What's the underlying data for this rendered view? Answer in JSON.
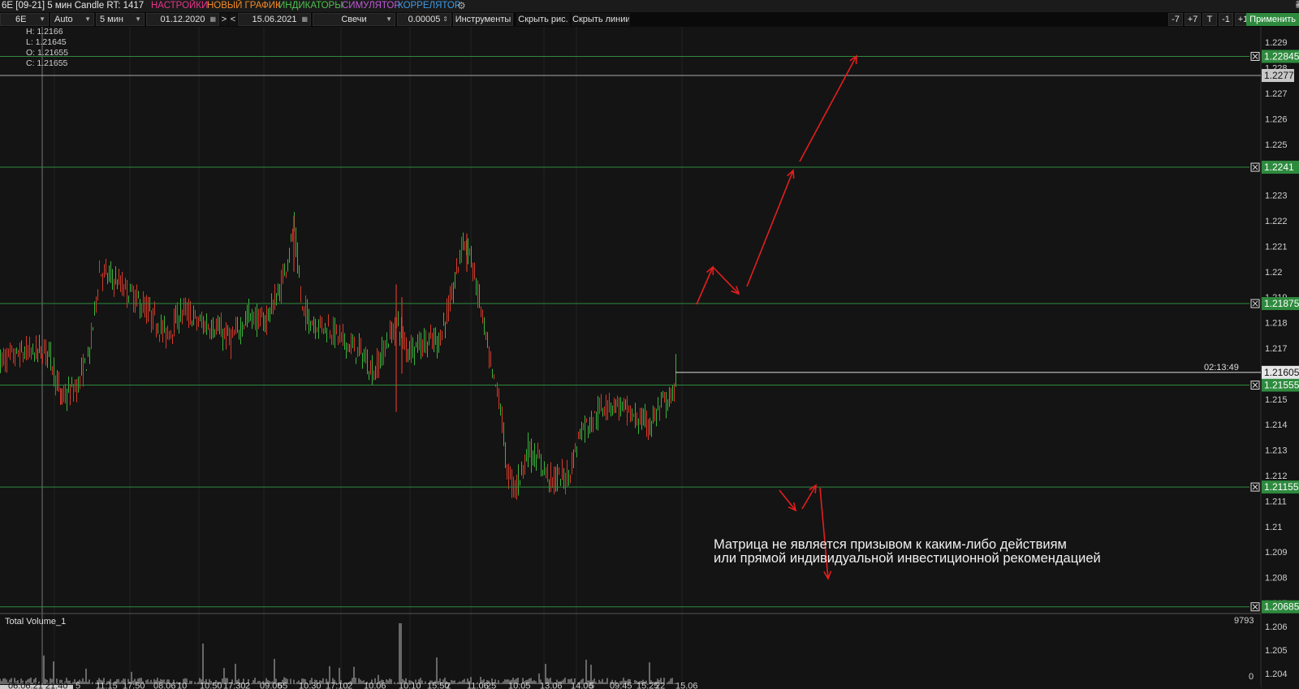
{
  "titlebar": {
    "instrument_title": "6E [09-21] 5 мин Candle RT: 1417",
    "menu": [
      {
        "label": "НАСТРОЙКИ",
        "color": "#e8348c"
      },
      {
        "label": "НОВЫЙ ГРАФИК",
        "color": "#f08a24"
      },
      {
        "label": "ИНДИКАТОРЫ",
        "color": "#4cc04c"
      },
      {
        "label": "СИМУЛЯТОР",
        "color": "#c05ad8"
      },
      {
        "label": "КОРРЕЛЯТОР",
        "color": "#3c9be8"
      }
    ],
    "settings_icon": "gears-icon"
  },
  "toolbar": {
    "symbol": "6E",
    "scale": "Auto",
    "timeframe": "5 мин",
    "date_from": "01.12.2020",
    "nav_next": ">",
    "nav_prev": "<",
    "date_to": "15.06.2021",
    "chart_type": "Свечи",
    "tick_size": "0.00005",
    "instruments": "Инструменты",
    "hide_drawings": "Скрыть рис.",
    "hide_lines": "Скрыть линии",
    "zoom_buttons": [
      "-7",
      "+7",
      "T",
      "-1",
      "+1"
    ],
    "apply": "Применить"
  },
  "ohlc": {
    "high": "H: 1.2166",
    "low": "L: 1.21645",
    "open": "O: 1.21655",
    "close": "C: 1.21655"
  },
  "chart_data": {
    "type": "candlestick",
    "ylim": [
      1.2065,
      1.2295
    ],
    "y_ticks": [
      "1.229",
      "1.228",
      "1.227",
      "1.226",
      "1.225",
      "1.224",
      "1.223",
      "1.222",
      "1.221",
      "1.22",
      "1.219",
      "1.218",
      "1.217",
      "1.216",
      "1.215",
      "1.214",
      "1.213",
      "1.212",
      "1.211",
      "1.21",
      "1.209",
      "1.208",
      "1.207"
    ],
    "x_tick_labels": [
      "06.06.21 21:40",
      "5",
      "11:15",
      "17:50",
      "08.06",
      "10",
      "10:50",
      "17:30",
      "2",
      "09.06",
      "55",
      "10:30",
      "17:10",
      "2",
      "10.06",
      "10:10",
      "15:50",
      "2",
      "11.06",
      "25",
      "10:05",
      "13.06",
      "14.06",
      "5",
      "09:45",
      "15:25",
      "22",
      "15.06"
    ],
    "price_path": [
      [
        0,
        1.2165
      ],
      [
        30,
        1.2168
      ],
      [
        60,
        1.2169
      ],
      [
        75,
        1.215
      ],
      [
        95,
        1.2155
      ],
      [
        110,
        1.2168
      ],
      [
        122,
        1.22
      ],
      [
        140,
        1.2197
      ],
      [
        165,
        1.219
      ],
      [
        185,
        1.2183
      ],
      [
        205,
        1.2175
      ],
      [
        225,
        1.2185
      ],
      [
        245,
        1.218
      ],
      [
        265,
        1.2178
      ],
      [
        285,
        1.2173
      ],
      [
        305,
        1.2183
      ],
      [
        325,
        1.218
      ],
      [
        345,
        1.2193
      ],
      [
        362,
        1.2217
      ],
      [
        372,
        1.2185
      ],
      [
        385,
        1.218
      ],
      [
        405,
        1.2178
      ],
      [
        425,
        1.2172
      ],
      [
        445,
        1.2168
      ],
      [
        460,
        1.216
      ],
      [
        480,
        1.2175
      ],
      [
        490,
        1.218
      ],
      [
        500,
        1.217
      ],
      [
        520,
        1.2172
      ],
      [
        540,
        1.2173
      ],
      [
        555,
        1.2188
      ],
      [
        570,
        1.2213
      ],
      [
        580,
        1.2205
      ],
      [
        595,
        1.218
      ],
      [
        605,
        1.216
      ],
      [
        615,
        1.215
      ],
      [
        625,
        1.212
      ],
      [
        635,
        1.2115
      ],
      [
        650,
        1.213
      ],
      [
        665,
        1.2125
      ],
      [
        680,
        1.2118
      ],
      [
        700,
        1.212
      ],
      [
        715,
        1.2138
      ],
      [
        730,
        1.2142
      ],
      [
        745,
        1.2148
      ],
      [
        760,
        1.2148
      ],
      [
        780,
        1.2143
      ],
      [
        800,
        1.214
      ],
      [
        815,
        1.2148
      ],
      [
        828,
        1.215
      ],
      [
        832,
        1.21605
      ]
    ],
    "volume_max_label": "9793",
    "volume_min_label": "0",
    "volume_title": "Total Volume_1",
    "volume_panel_ticks": [
      "1.206",
      "1.205",
      "1.204"
    ],
    "horizontal_levels": [
      {
        "value": 1.22845,
        "label": "1.22845",
        "color": "#2e8b3e"
      },
      {
        "value": 1.2241,
        "label": "1.2241",
        "color": "#2e8b3e"
      },
      {
        "value": 1.21875,
        "label": "1.21875",
        "color": "#2e8b3e"
      },
      {
        "value": 1.21555,
        "label": "1.21555",
        "color": "#2e8b3e"
      },
      {
        "value": 1.21155,
        "label": "1.21155",
        "color": "#2e8b3e"
      },
      {
        "value": 1.20685,
        "label": "1.20685",
        "color": "#2e8b3e"
      }
    ],
    "price_marker": {
      "value": 1.2277,
      "label": "1.2277"
    },
    "current_price": {
      "value": 1.21605,
      "label": "1.21605",
      "timer": "02:13:49"
    },
    "colors": {
      "up": "#3cb33c",
      "down": "#d43a2a",
      "level": "#2e8b3e",
      "arrow": "#e41e1e"
    }
  },
  "disclaimer": {
    "line1": "Матрица не является призывом к каким-либо действиям",
    "line2": "или прямой индивидуальной инвестиционной рекомендацией"
  }
}
